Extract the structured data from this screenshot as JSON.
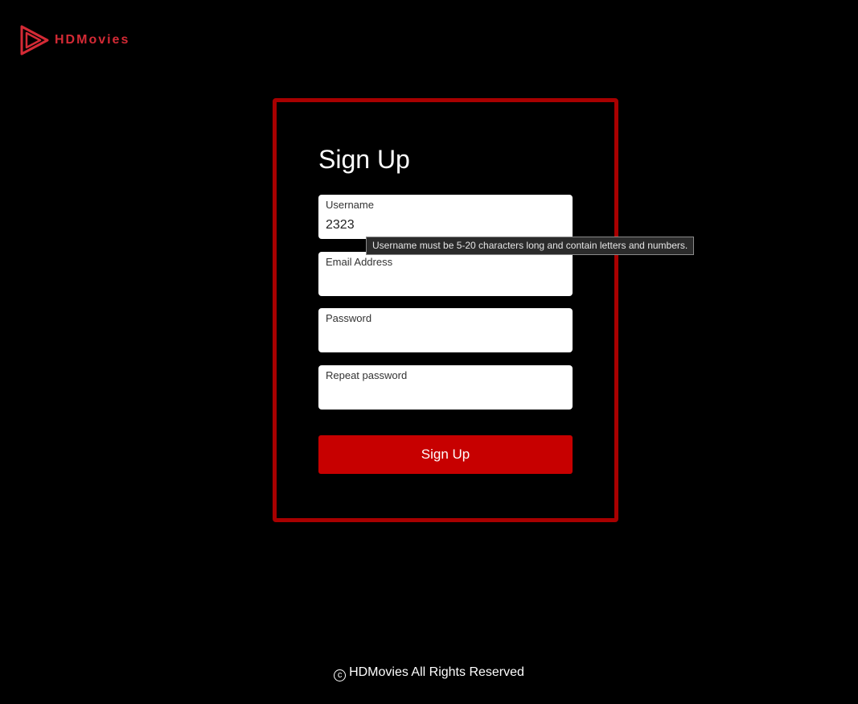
{
  "brand": {
    "name": "HDMovies",
    "logo_icon": "play-triangle-icon",
    "color": "#d42a35"
  },
  "signup": {
    "title": "Sign Up",
    "fields": [
      {
        "label": "Username",
        "value": "2323"
      },
      {
        "label": "Email Address",
        "value": ""
      },
      {
        "label": "Password",
        "value": ""
      },
      {
        "label": "Repeat password",
        "value": ""
      }
    ],
    "submit_label": "Sign Up",
    "tooltip": "Username must be 5-20 characters long and contain letters and numbers."
  },
  "footer": {
    "copyright_icon": "copyright-icon",
    "copyright_symbol": "c",
    "text": "HDMovies All Rights Reserved"
  },
  "colors": {
    "background": "#000000",
    "card_border": "#a80000",
    "button": "#c70000"
  }
}
